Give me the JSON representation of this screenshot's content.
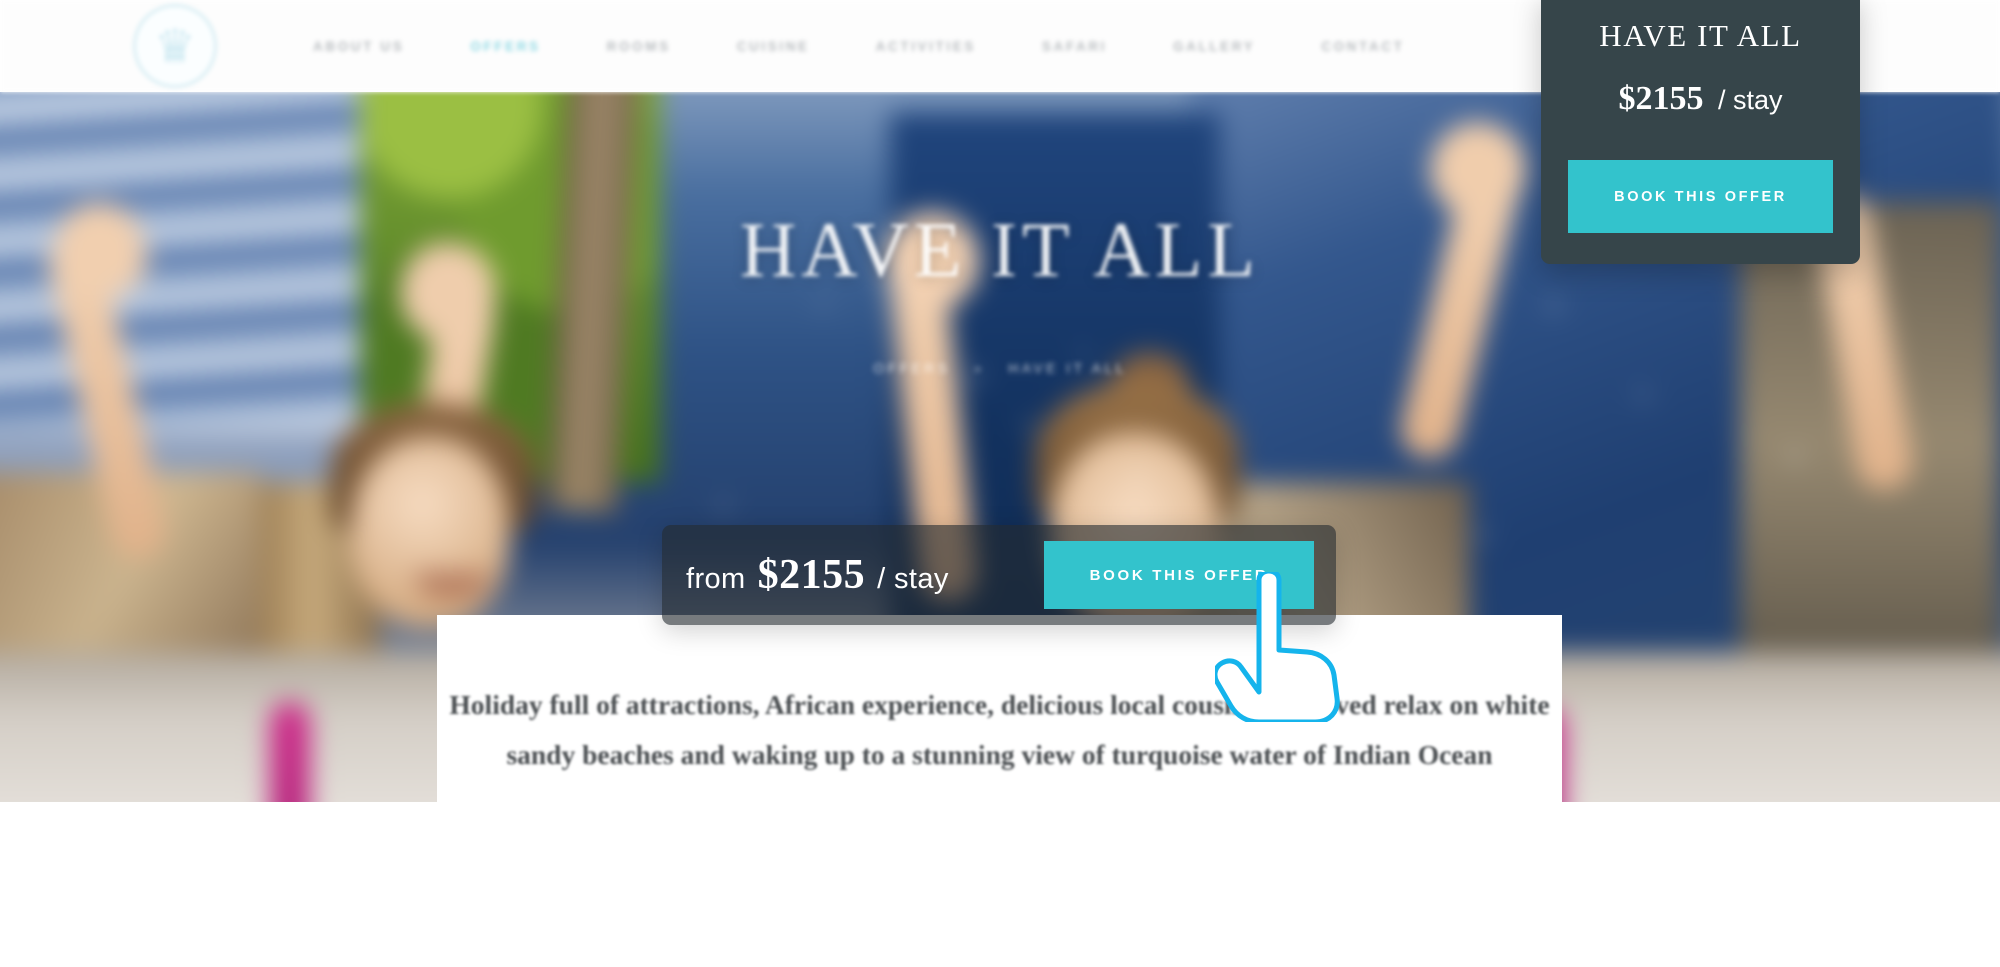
{
  "header": {
    "logo_icon": "crown-palm-logo-icon",
    "nav": [
      {
        "label": "ABOUT US",
        "active": false
      },
      {
        "label": "OFFERS",
        "active": true
      },
      {
        "label": "ROOMS",
        "active": false
      },
      {
        "label": "CUISINE",
        "active": false
      },
      {
        "label": "ACTIVITIES",
        "active": false
      },
      {
        "label": "SAFARI",
        "active": false
      },
      {
        "label": "GALLERY",
        "active": false
      },
      {
        "label": "CONTACT",
        "active": false
      }
    ]
  },
  "hero": {
    "title": "HAVE IT ALL",
    "breadcrumb": {
      "parent": "OFFERS",
      "separator": "»",
      "current": "HAVE IT ALL"
    }
  },
  "price_bar": {
    "from_label": "from",
    "amount": "$2155",
    "unit": "/ stay",
    "book_button": "BOOK THIS OFFER"
  },
  "offer_panel": {
    "title": "HAVE IT ALL",
    "amount": "$2155",
    "unit": "/ stay",
    "book_button": "BOOK THIS OFFER"
  },
  "content": {
    "paragraph": "Holiday full of attractions, African experience, delicious local cousine, deserved relax on white sandy beaches and waking up to a stunning view of turquoise water of Indian Ocean"
  },
  "cursor": {
    "icon": "pointing-hand-cursor-icon"
  },
  "colors": {
    "accent_teal": "#33C3CC",
    "panel_dark": "#36454A",
    "nav_active": "#8FD9E4",
    "nav_idle": "#B9BDC0",
    "cursor_outline": "#15B4EC",
    "body_text": "#4B4F52"
  }
}
